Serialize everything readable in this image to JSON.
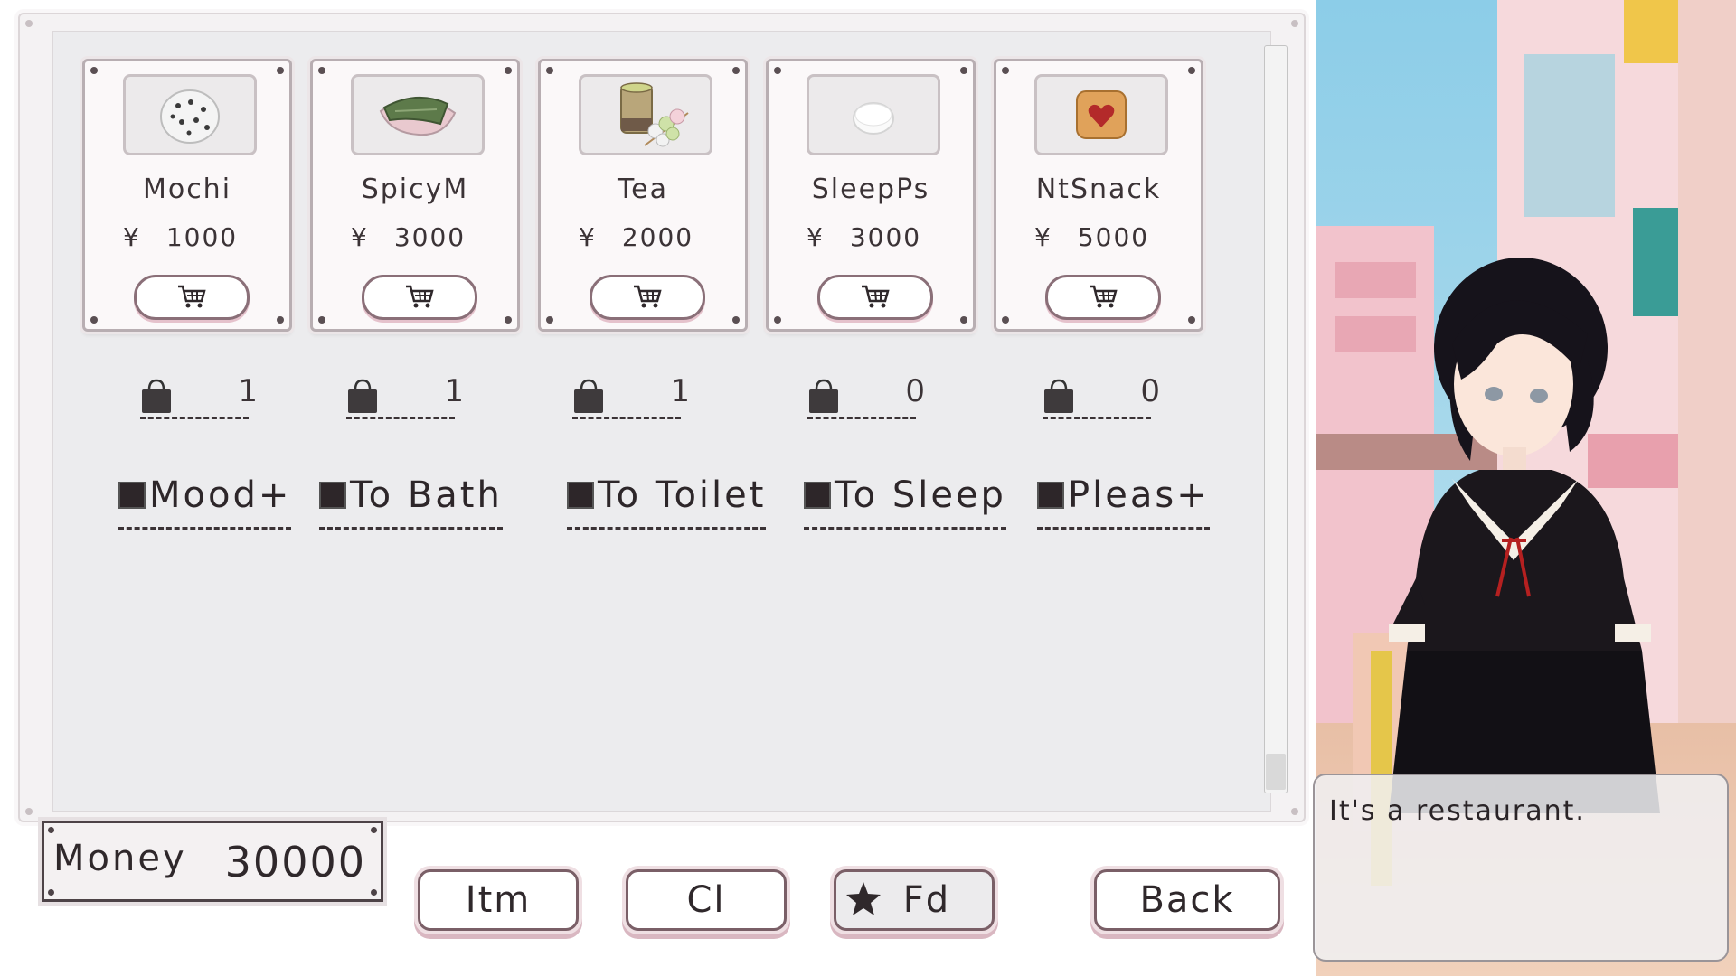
{
  "shop": {
    "items": [
      {
        "name": "Mochi",
        "currency": "¥",
        "price": "1000",
        "owned": "1",
        "effect": "Mood+",
        "icon": "mochi-icon"
      },
      {
        "name": "SpicyM",
        "currency": "¥",
        "price": "3000",
        "owned": "1",
        "effect": "To Bath",
        "icon": "spicy-mochi-icon"
      },
      {
        "name": "Tea",
        "currency": "¥",
        "price": "2000",
        "owned": "1",
        "effect": "To Toilet",
        "icon": "tea-dango-icon"
      },
      {
        "name": "SleepPs",
        "currency": "¥",
        "price": "3000",
        "owned": "0",
        "effect": "To Sleep",
        "icon": "sleeping-pills-icon"
      },
      {
        "name": "NtSnack",
        "currency": "¥",
        "price": "5000",
        "owned": "0",
        "effect": "Pleas+",
        "icon": "heart-cookie-icon"
      }
    ]
  },
  "money": {
    "label": "Money",
    "value": "30000"
  },
  "tabs": {
    "items": "Itm",
    "clothes": "Cl",
    "food": "Fd",
    "back": "Back"
  },
  "dialogue": {
    "text": "It's a restaurant."
  },
  "colors": {
    "accent_pink": "#e5c2cc",
    "panel_bg": "#f4f2f3",
    "dark_text": "#2f282b"
  }
}
